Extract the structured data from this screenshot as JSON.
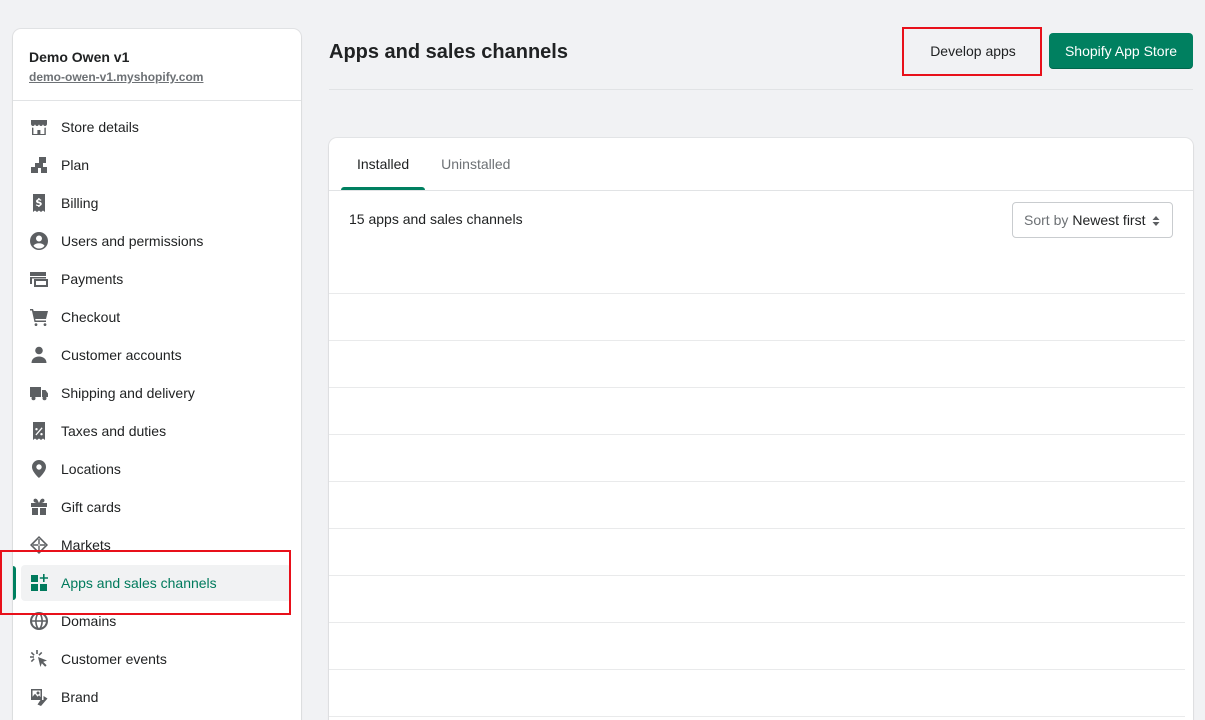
{
  "store": {
    "name": "Demo Owen v1",
    "url": "demo-owen-v1.myshopify.com"
  },
  "sidebar": {
    "items": [
      {
        "label": "Store details",
        "icon": "store-icon"
      },
      {
        "label": "Plan",
        "icon": "plan-icon"
      },
      {
        "label": "Billing",
        "icon": "billing-icon"
      },
      {
        "label": "Users and permissions",
        "icon": "user-circle-icon"
      },
      {
        "label": "Payments",
        "icon": "payments-icon"
      },
      {
        "label": "Checkout",
        "icon": "cart-icon"
      },
      {
        "label": "Customer accounts",
        "icon": "person-icon"
      },
      {
        "label": "Shipping and delivery",
        "icon": "truck-icon"
      },
      {
        "label": "Taxes and duties",
        "icon": "tax-receipt-icon"
      },
      {
        "label": "Locations",
        "icon": "location-pin-icon"
      },
      {
        "label": "Gift cards",
        "icon": "gift-icon"
      },
      {
        "label": "Markets",
        "icon": "globe-icon"
      },
      {
        "label": "Apps and sales channels",
        "icon": "apps-icon",
        "active": true
      },
      {
        "label": "Domains",
        "icon": "domains-globe-icon"
      },
      {
        "label": "Customer events",
        "icon": "cursor-click-icon"
      },
      {
        "label": "Brand",
        "icon": "brand-icon"
      }
    ]
  },
  "main": {
    "title": "Apps and sales channels",
    "develop_apps_label": "Develop apps",
    "app_store_label": "Shopify App Store",
    "tabs": [
      {
        "label": "Installed",
        "selected": true
      },
      {
        "label": "Uninstalled",
        "selected": false
      }
    ],
    "count_text": "15 apps and sales channels",
    "sort": {
      "prefix": "Sort by",
      "value": "Newest first"
    }
  },
  "colors": {
    "accent": "#008060",
    "highlight": "#e8101a"
  }
}
